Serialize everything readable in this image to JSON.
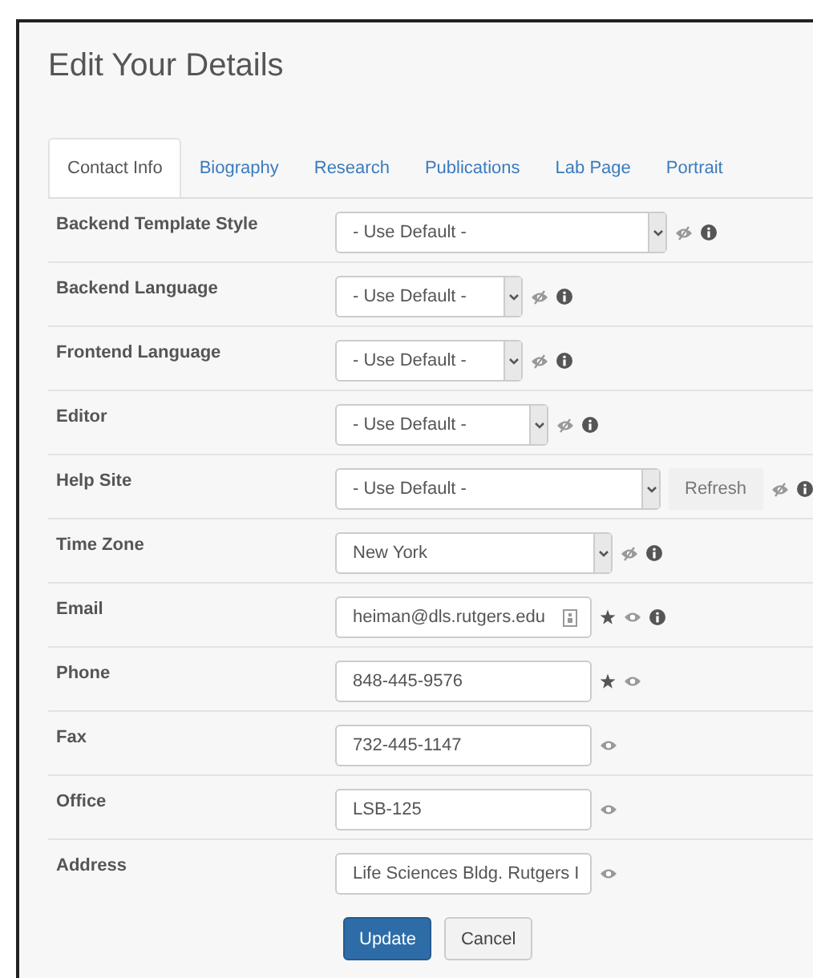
{
  "title": "Edit Your Details",
  "tabs": [
    {
      "label": "Contact Info",
      "selected": true
    },
    {
      "label": "Biography",
      "selected": false
    },
    {
      "label": "Research",
      "selected": false
    },
    {
      "label": "Publications",
      "selected": false
    },
    {
      "label": "Lab Page",
      "selected": false
    },
    {
      "label": "Portrait",
      "selected": false
    }
  ],
  "fields": [
    {
      "label": "Backend Template Style",
      "kind": "select",
      "value": "- Use Default -",
      "starred": false,
      "hidden": true,
      "info": true
    },
    {
      "label": "Backend Language",
      "kind": "select",
      "value": "- Use Default -",
      "starred": false,
      "hidden": true,
      "info": true
    },
    {
      "label": "Frontend Language",
      "kind": "select",
      "value": "- Use Default -",
      "starred": false,
      "hidden": true,
      "info": true
    },
    {
      "label": "Editor",
      "kind": "select",
      "value": "- Use Default -",
      "starred": false,
      "hidden": true,
      "info": true
    },
    {
      "label": "Help Site",
      "kind": "select",
      "value": "- Use Default -",
      "button": "Refresh",
      "starred": false,
      "hidden": true,
      "info": true
    },
    {
      "label": "Time Zone",
      "kind": "select",
      "value": "New York",
      "starred": false,
      "hidden": true,
      "info": true
    },
    {
      "label": "Email",
      "kind": "input",
      "value": "heiman@dls.rutgers.edu",
      "card_icon": true,
      "starred": true,
      "hidden": false,
      "info": true
    },
    {
      "label": "Phone",
      "kind": "input",
      "value": "848-445-9576",
      "starred": true,
      "hidden": false,
      "info": false
    },
    {
      "label": "Fax",
      "kind": "input",
      "value": "732-445-1147",
      "starred": false,
      "hidden": false,
      "info": false
    },
    {
      "label": "Office",
      "kind": "input",
      "value": "LSB-125",
      "starred": false,
      "hidden": false,
      "info": false
    },
    {
      "label": "Address",
      "kind": "input",
      "value": "Life Sciences Bldg. Rutgers I",
      "starred": false,
      "hidden": false,
      "info": false
    }
  ],
  "buttons": [
    {
      "label": "Update",
      "kind": "primary"
    },
    {
      "label": "Cancel",
      "kind": "default"
    }
  ]
}
